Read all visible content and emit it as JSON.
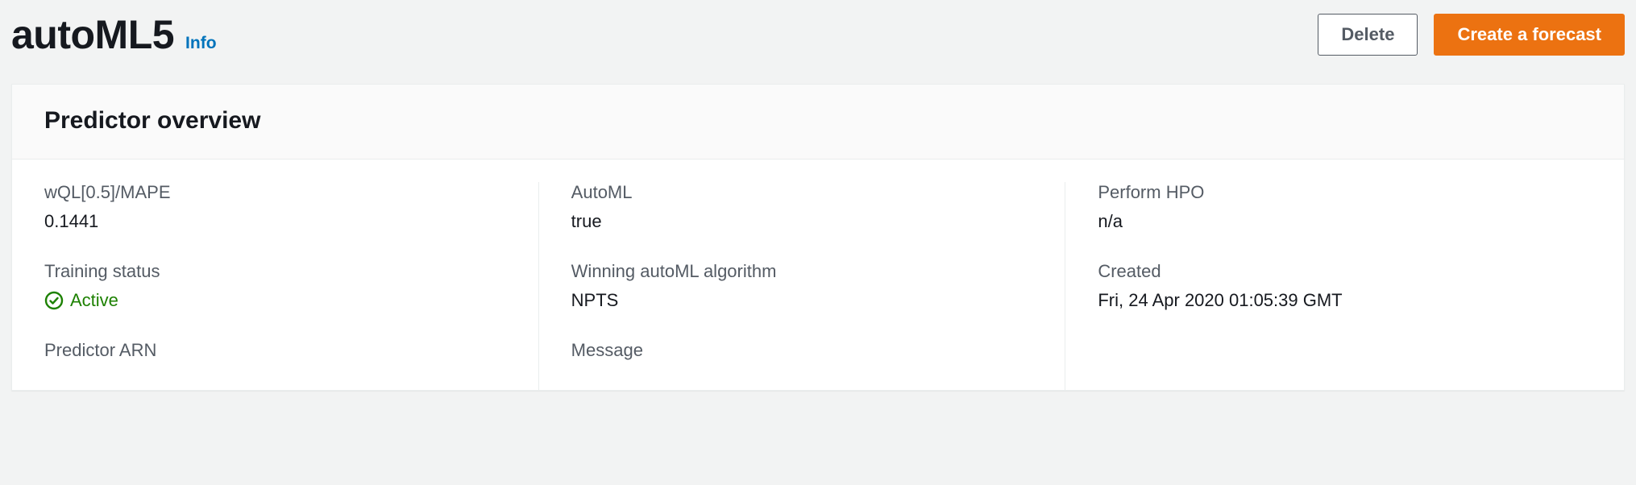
{
  "header": {
    "title": "autoML5",
    "info_link": "Info",
    "actions": {
      "delete": "Delete",
      "create_forecast": "Create a forecast"
    }
  },
  "panel": {
    "title": "Predictor overview",
    "col1": {
      "wql_label": "wQL[0.5]/MAPE",
      "wql_value": "0.1441",
      "training_status_label": "Training status",
      "training_status_value": "Active",
      "predictor_arn_label": "Predictor ARN"
    },
    "col2": {
      "automl_label": "AutoML",
      "automl_value": "true",
      "winning_algo_label": "Winning autoML algorithm",
      "winning_algo_value": "NPTS",
      "message_label": "Message"
    },
    "col3": {
      "hpo_label": "Perform HPO",
      "hpo_value": "n/a",
      "created_label": "Created",
      "created_value": "Fri, 24 Apr 2020 01:05:39 GMT"
    }
  }
}
